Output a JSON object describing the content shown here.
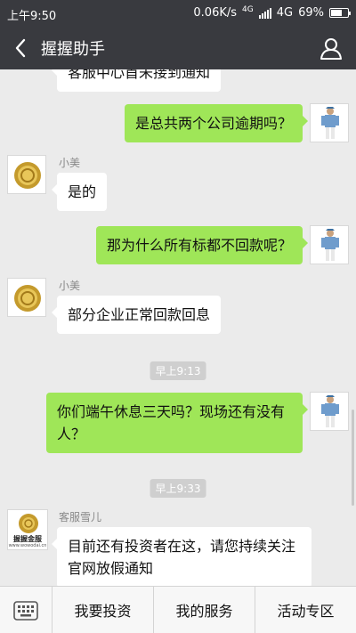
{
  "status": {
    "time": "上午9:50",
    "speed": "0.06K/s",
    "net_small": "4G",
    "net": "4G",
    "battery": "69%",
    "battery_level": 0.69
  },
  "header": {
    "title": "握握助手"
  },
  "messages": {
    "m0": {
      "text": "客服中心首未接到通知"
    },
    "m1": {
      "text": "是总共两个公司逾期吗？"
    },
    "m2": {
      "sender": "小美",
      "text": "是的"
    },
    "m3": {
      "text": "那为什么所有标都不回款呢？"
    },
    "m4": {
      "sender": "小美",
      "text": "部分企业正常回款回息"
    },
    "t1": "早上9:13",
    "m5": {
      "text": "你们端午休息三天吗？现场还有没有人？"
    },
    "t2": "早上9:33",
    "m6": {
      "sender": "客服雪儿",
      "text": "目前还有投资者在这，请您持续关注官网放假通知",
      "avatar_label": "握握金服",
      "avatar_url": "www.wowodai.cn"
    }
  },
  "menu": {
    "items": [
      "我要投资",
      "我的服务",
      "活动专区"
    ]
  },
  "colors": {
    "bar": "#393a3f",
    "sent_bubble": "#9fe658",
    "recv_bubble": "#ffffff",
    "background": "#ebebeb"
  },
  "icons": {
    "back": "chevron-left-icon",
    "profile": "person-icon",
    "keyboard": "keyboard-icon"
  }
}
